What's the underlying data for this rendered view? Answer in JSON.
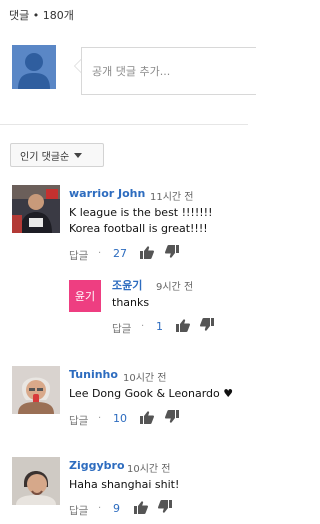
{
  "header": {
    "comment_count": "댓글 • 180개"
  },
  "composer": {
    "placeholder": "공개 댓글 추가..."
  },
  "sort": {
    "label": "인기 댓글순"
  },
  "reply_label": "답글",
  "dot": "·",
  "comments": [
    {
      "author": "warrior John",
      "time": "11시간 전",
      "lines": [
        "K league is the best !!!!!!!",
        "Korea football is great!!!!"
      ],
      "likes": "27"
    },
    {
      "author": "조윤기",
      "time": "9시간 전",
      "badge": "윤기",
      "lines": [
        "thanks"
      ],
      "likes": "1",
      "badge_color": "#ee3e81"
    },
    {
      "author": "Tuninho",
      "time": "10시간 전",
      "lines": [
        "Lee Dong Gook &  Leonardo ♥"
      ],
      "likes": "10"
    },
    {
      "author": "Ziggybro",
      "time": "10시간 전",
      "lines": [
        "Haha shanghai shit!"
      ],
      "likes": "9"
    }
  ],
  "colors": {
    "link": "#2d6cbf",
    "avatar_default": "#5a87c6"
  }
}
